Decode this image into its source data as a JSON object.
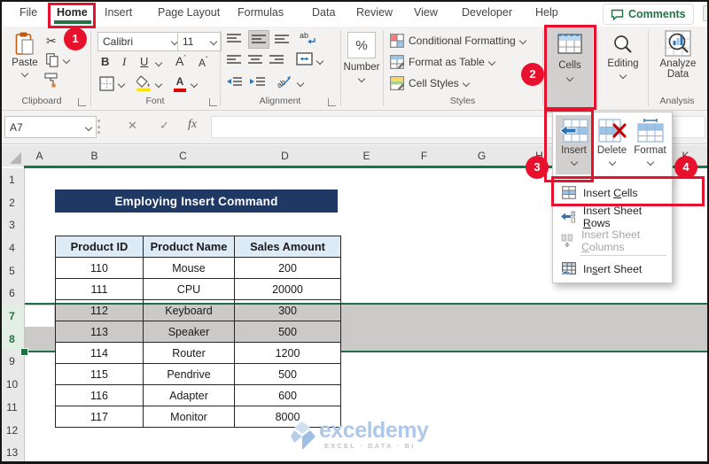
{
  "tabs": [
    "File",
    "Home",
    "Insert",
    "Page Layout",
    "Formulas",
    "Data",
    "Review",
    "View",
    "Developer",
    "Help"
  ],
  "window": {
    "comments_label": "Comments"
  },
  "ribbon": {
    "clipboard": {
      "group": "Clipboard",
      "paste": "Paste"
    },
    "font": {
      "group": "Font",
      "name": "Calibri",
      "size": "11",
      "bold": "B",
      "italic": "I",
      "underline": "U"
    },
    "alignment": {
      "group": "Alignment"
    },
    "number": {
      "label": "Number",
      "percent": "%"
    },
    "styles": {
      "group": "Styles",
      "cf": "Conditional Formatting",
      "fat": "Format as Table",
      "cs": "Cell Styles"
    },
    "cells": {
      "label": "Cells"
    },
    "editing": {
      "label": "Editing"
    },
    "analysis": {
      "group": "Analysis",
      "line1": "Analyze",
      "line2": "Data"
    }
  },
  "formula_bar": {
    "name_box": "A7",
    "fx": "fx"
  },
  "sheet": {
    "columns": [
      "A",
      "B",
      "C",
      "D",
      "E",
      "F",
      "G",
      "H"
    ],
    "column_k": "K",
    "rows": [
      "1",
      "2",
      "3",
      "4",
      "5",
      "6",
      "7",
      "8",
      "9",
      "10",
      "11",
      "12",
      "13"
    ],
    "banner": "Employing Insert Command",
    "table": {
      "headers": [
        "Product ID",
        "Product Name",
        "Sales Amount"
      ],
      "data": [
        [
          "110",
          "Mouse",
          "200"
        ],
        [
          "111",
          "CPU",
          "20000"
        ],
        [
          "112",
          "Keyboard",
          "300"
        ],
        [
          "113",
          "Speaker",
          "500"
        ],
        [
          "114",
          "Router",
          "1200"
        ],
        [
          "115",
          "Pendrive",
          "500"
        ],
        [
          "116",
          "Adapter",
          "600"
        ],
        [
          "117",
          "Monitor",
          "8000"
        ]
      ]
    }
  },
  "flyout": {
    "insert": "Insert",
    "delete": "Delete",
    "format": "Format"
  },
  "menu": {
    "items": [
      {
        "pre": "Insert ",
        "key": "C",
        "post": "ells"
      },
      {
        "pre": "Insert Sheet ",
        "key": "R",
        "post": "ows"
      },
      {
        "pre": "Insert Sheet ",
        "key": "C",
        "post": "olumns"
      },
      {
        "pre": "In",
        "key": "s",
        "post": "ert Sheet"
      }
    ]
  },
  "callouts": [
    "1",
    "2",
    "3",
    "4"
  ],
  "watermark": {
    "brand": "exceldemy",
    "tagline": "EXCEL · DATA · BI"
  },
  "colors": {
    "excel_green": "#217346",
    "selection_green": "#1e7145",
    "header_underline_green": "#107c41",
    "annotation_red": "#e8112d",
    "banner_navy": "#1f3864",
    "table_header_blue": "#ddebf7",
    "selection_gray": "#cbcac9",
    "ribbon_gray": "#f3f2f1"
  }
}
